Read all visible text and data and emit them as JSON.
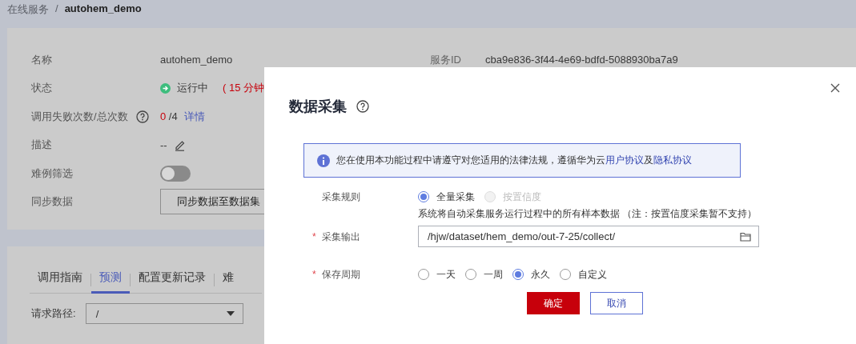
{
  "breadcrumb": {
    "parent": "在线服务",
    "separator": "/",
    "current": "autohem_demo"
  },
  "details": {
    "fields": [
      {
        "kind": "text",
        "label": "名称",
        "value": "autohem_demo"
      },
      {
        "kind": "status",
        "label": "状态",
        "value": "运行中",
        "note": "( 15 分钟"
      },
      {
        "kind": "counts",
        "label": "调用失败次数/总次数",
        "failed": "0",
        "total": "/4",
        "link": "详情"
      },
      {
        "kind": "description",
        "label": "描述",
        "value": "--"
      },
      {
        "kind": "toggle",
        "label": "难例筛选",
        "on": false
      },
      {
        "kind": "button",
        "label": "同步数据",
        "button": "同步数据至数据集"
      }
    ],
    "service_id": {
      "label": "服务ID",
      "value": "cba9e836-3f44-4e69-bdfd-5088930ba7a9"
    }
  },
  "tabs": [
    {
      "label": "调用指南",
      "selected": false
    },
    {
      "label": "预测",
      "selected": true
    },
    {
      "label": "配置更新记录",
      "selected": false
    },
    {
      "label": "难",
      "selected": false
    }
  ],
  "request_path": {
    "label": "请求路径:",
    "value": "/"
  },
  "dialog": {
    "title": "数据采集",
    "alert": [
      {
        "kind": "text",
        "text": "您在使用本功能过程中请遵守对您适用的法律法规，遵循华为云"
      },
      {
        "kind": "link",
        "text": "用户协议"
      },
      {
        "kind": "text",
        "text": "及"
      },
      {
        "kind": "link",
        "text": "隐私协议"
      }
    ],
    "rows": [
      {
        "kind": "radios",
        "label": "采集规则",
        "options": [
          {
            "label": "全量采集",
            "selected": true,
            "disabled": false
          },
          {
            "label": "按置信度",
            "selected": false,
            "disabled": true
          }
        ],
        "hint": "系统将自动采集服务运行过程中的所有样本数据 （注：按置信度采集暂不支持）"
      },
      {
        "kind": "path",
        "label": "采集输出",
        "required_mark": "*",
        "value": "/hjw/dataset/hem_demo/out-7-25/collect/"
      },
      {
        "kind": "radios",
        "label": "保存周期",
        "required_mark": "*",
        "options": [
          {
            "label": "一天",
            "selected": false,
            "disabled": false
          },
          {
            "label": "一周",
            "selected": false,
            "disabled": false
          },
          {
            "label": "永久",
            "selected": true,
            "disabled": false
          },
          {
            "label": "自定义",
            "selected": false,
            "disabled": false
          }
        ]
      }
    ],
    "buttons": [
      {
        "label": "确定",
        "kind": "primary"
      },
      {
        "label": "取消",
        "kind": "secondary"
      }
    ]
  }
}
